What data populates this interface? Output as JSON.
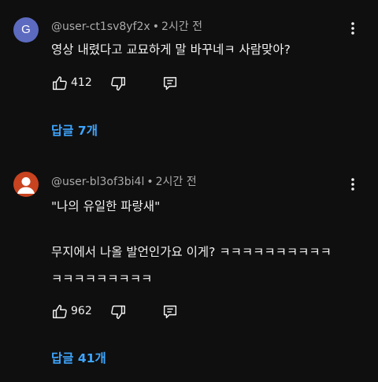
{
  "comments": [
    {
      "author": "@user-ct1sv8yf2x",
      "separator": "•",
      "time": "2시간 전",
      "avatar_letter": "G",
      "avatar_color": "#5c6bc0",
      "lines": [
        "영상 내렸다고 교묘하게 말 바꾸네ㅋ 사람맞아?"
      ],
      "likes": "412",
      "replies_label": "답글 7개"
    },
    {
      "author": "@user-bl3of3bi4l",
      "separator": "•",
      "time": "2시간 전",
      "avatar_color": "#c8431f",
      "lines": [
        "\"나의 유일한 파랑새\"",
        "",
        "무지에서 나올 발언인가요 이게? ㅋㅋㅋㅋㅋㅋㅋㅋㅋㅋ",
        "ㅋㅋㅋㅋㅋㅋㅋㅋㅋ"
      ],
      "likes": "962",
      "replies_label": "답글 41개"
    }
  ],
  "icons": {
    "like": "thumbs-up-icon",
    "dislike": "thumbs-down-icon",
    "reply": "reply-comment-icon",
    "more": "more-vertical-icon"
  },
  "colors": {
    "background": "#0f0f0f",
    "text_primary": "#f1f1f1",
    "text_secondary": "#aaaaaa",
    "link_blue": "#3ea6ff"
  }
}
